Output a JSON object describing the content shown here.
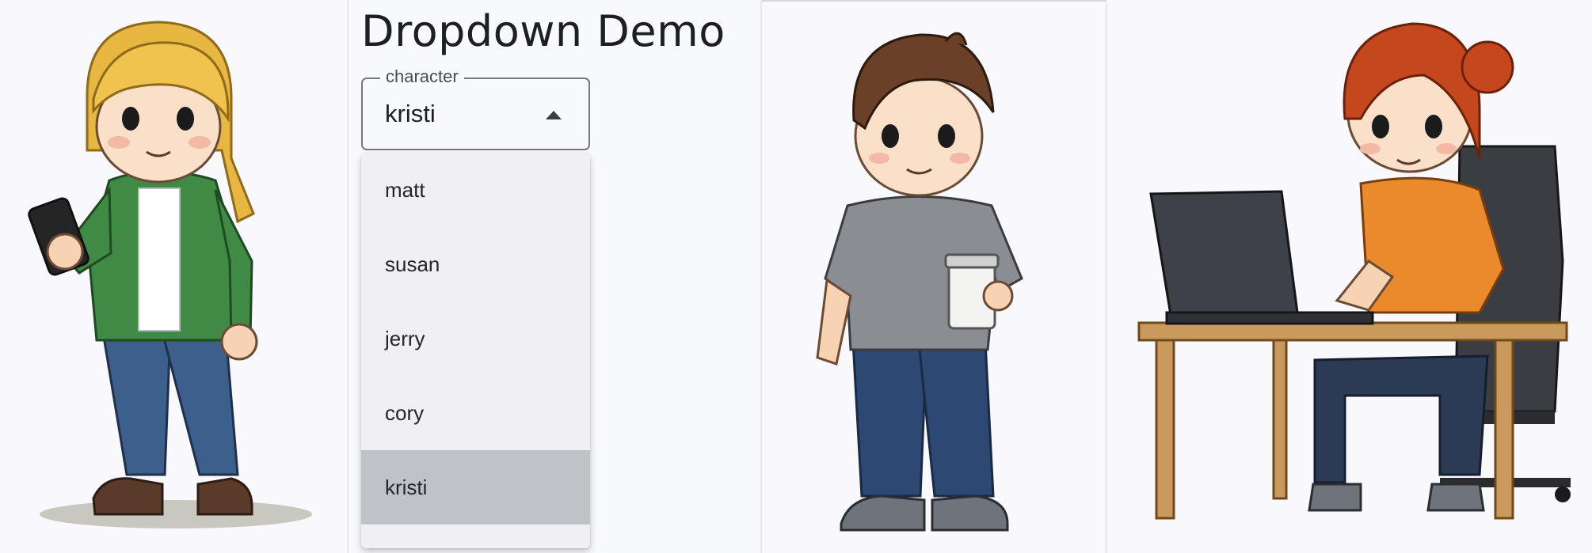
{
  "demo": {
    "title": "Dropdown Demo",
    "select": {
      "label": "character",
      "value": "kristi",
      "expanded": true,
      "options": [
        "matt",
        "susan",
        "jerry",
        "cory",
        "kristi"
      ],
      "selected_index": 4
    }
  },
  "icons": {
    "caret": "caret-up-icon"
  },
  "colors": {
    "background": "#f8f9fe",
    "menu_background": "#efeff4",
    "selected_option": "#c1c2c7",
    "field_border": "#77777c"
  }
}
